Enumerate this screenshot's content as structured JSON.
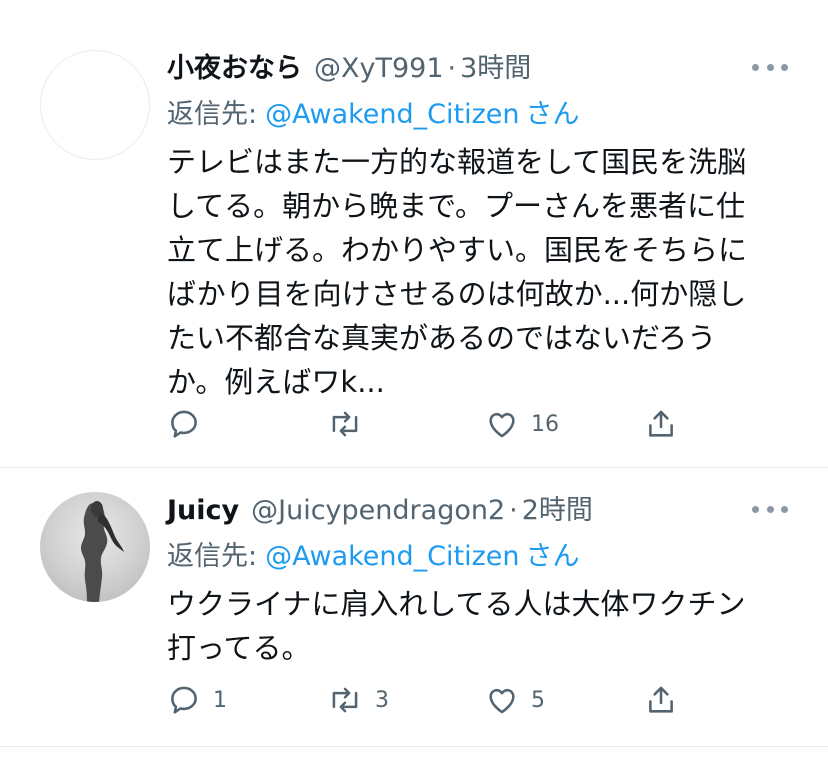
{
  "tweets": [
    {
      "name": "小夜おなら",
      "handle": "@XyT991",
      "separator": "·",
      "time": "3時間",
      "reply_prefix": "返信先:",
      "reply_mention": "@Awakend_Citizen",
      "reply_suffix": "さん",
      "text": "テレビはまた一方的な報道をして国民を洗脳\nしてる。朝から晩まで。プーさんを悪者に仕\n立て上げる。わかりやすい。国民をそちらに\nばかり目を向けさせるのは何故か...何か隠し\nたい不都合な真実があるのではないだろう\nか。例えばワk...",
      "reply_count": "",
      "retweet_count": "",
      "like_count": "16"
    },
    {
      "name": "Juicy",
      "handle": "@Juicypendragon2",
      "separator": "·",
      "time": "2時間",
      "reply_prefix": "返信先:",
      "reply_mention": "@Awakend_Citizen",
      "reply_suffix": "さん",
      "text": "ウクライナに肩入れしてる人は大体ワクチン\n打ってる。",
      "reply_count": "1",
      "retweet_count": "3",
      "like_count": "5"
    }
  ],
  "icons": {
    "reply": "reply-icon",
    "retweet": "retweet-icon",
    "like": "heart-icon",
    "share": "share-icon",
    "more": "more-icon"
  },
  "colors": {
    "text": "#0f1419",
    "secondary": "#536471",
    "link": "#1d9bf0",
    "divider": "#e6ecf0"
  }
}
